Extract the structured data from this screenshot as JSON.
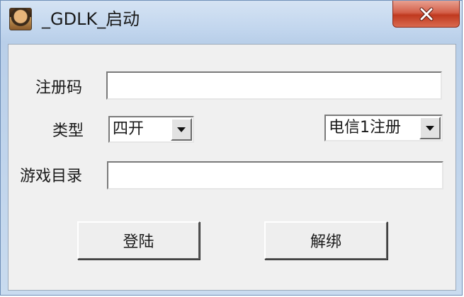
{
  "window": {
    "title": "_GDLK_启动",
    "close_label": "×"
  },
  "form": {
    "reg_code_label": "注册码",
    "reg_code_value": "",
    "type_label": "类型",
    "type_selected": "四开",
    "server_selected": "电信1注册",
    "game_dir_label": "游戏目录",
    "game_dir_value": ""
  },
  "buttons": {
    "login_label": "登陆",
    "unbind_label": "解绑"
  },
  "colors": {
    "titlebar": "#c2d6ee",
    "close_button": "#c0391f",
    "client_bg": "#f0f0f0"
  },
  "icons": {
    "app": "app-avatar-icon",
    "close": "close-icon",
    "dropdown": "chevron-down-icon"
  }
}
